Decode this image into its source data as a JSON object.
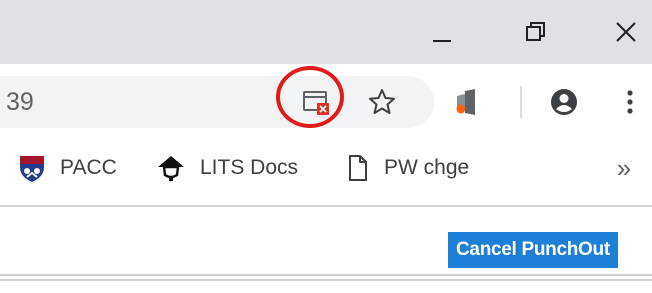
{
  "window": {
    "minimize_label": "—",
    "maximize_icon": "restore-icon",
    "close_label": "✕"
  },
  "toolbar": {
    "url_partial": "39",
    "icons": [
      "popup-blocked-icon",
      "bookmark-star-icon",
      "office-extension-icon",
      "profile-icon",
      "menu-dots-icon"
    ],
    "highlight_color": "#e01b1b"
  },
  "bookmarks": {
    "items": [
      {
        "label": "PACC",
        "icon": "shield-crest-icon"
      },
      {
        "label": "LITS Docs",
        "icon": "lamp-icon"
      },
      {
        "label": "PW chge",
        "icon": "page-icon"
      }
    ],
    "overflow_label": "»"
  },
  "page": {
    "cancel_button_label": "Cancel PunchOut",
    "accent_color": "#1e7fd6"
  }
}
